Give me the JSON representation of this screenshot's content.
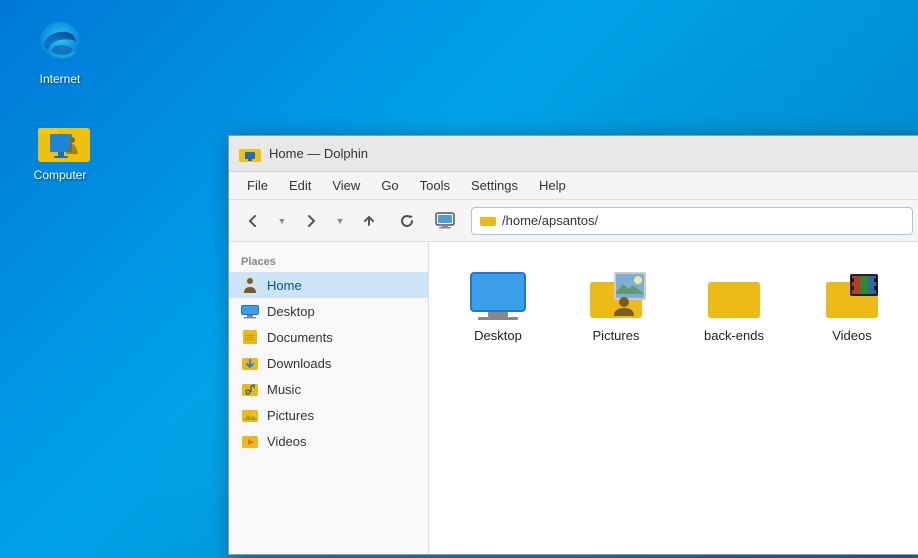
{
  "desktop": {
    "background_color": "#0078d7",
    "icons": [
      {
        "id": "internet",
        "label": "Internet",
        "type": "edge"
      },
      {
        "id": "computer",
        "label": "Computer",
        "type": "folder-computer"
      }
    ]
  },
  "window": {
    "title": "Home — Dolphin",
    "titlebar_folder": true
  },
  "menubar": {
    "items": [
      "File",
      "Edit",
      "View",
      "Go",
      "Tools",
      "Settings",
      "Help"
    ]
  },
  "toolbar": {
    "back_label": "←",
    "forward_label": "→",
    "up_label": "↑",
    "reload_label": "↺",
    "monitor_label": "🖥"
  },
  "address": {
    "path": "/home/apsantos/"
  },
  "sidebar": {
    "section_label": "Places",
    "items": [
      {
        "id": "home",
        "label": "Home",
        "active": true,
        "icon": "home"
      },
      {
        "id": "desktop",
        "label": "Desktop",
        "active": false,
        "icon": "desktop-folder"
      },
      {
        "id": "documents",
        "label": "Documents",
        "active": false,
        "icon": "documents"
      },
      {
        "id": "downloads",
        "label": "Downloads",
        "active": false,
        "icon": "downloads"
      },
      {
        "id": "music",
        "label": "Music",
        "active": false,
        "icon": "music"
      },
      {
        "id": "pictures",
        "label": "Pictures",
        "active": false,
        "icon": "pictures"
      },
      {
        "id": "videos",
        "label": "Videos",
        "active": false,
        "icon": "videos"
      }
    ]
  },
  "files": {
    "items": [
      {
        "id": "desktop",
        "label": "Desktop",
        "type": "desktop-screen"
      },
      {
        "id": "pictures",
        "label": "Pictures",
        "type": "folder-photos"
      },
      {
        "id": "back-ends",
        "label": "back-ends",
        "type": "folder-plain"
      },
      {
        "id": "videos",
        "label": "Videos",
        "type": "folder-videos"
      }
    ]
  }
}
